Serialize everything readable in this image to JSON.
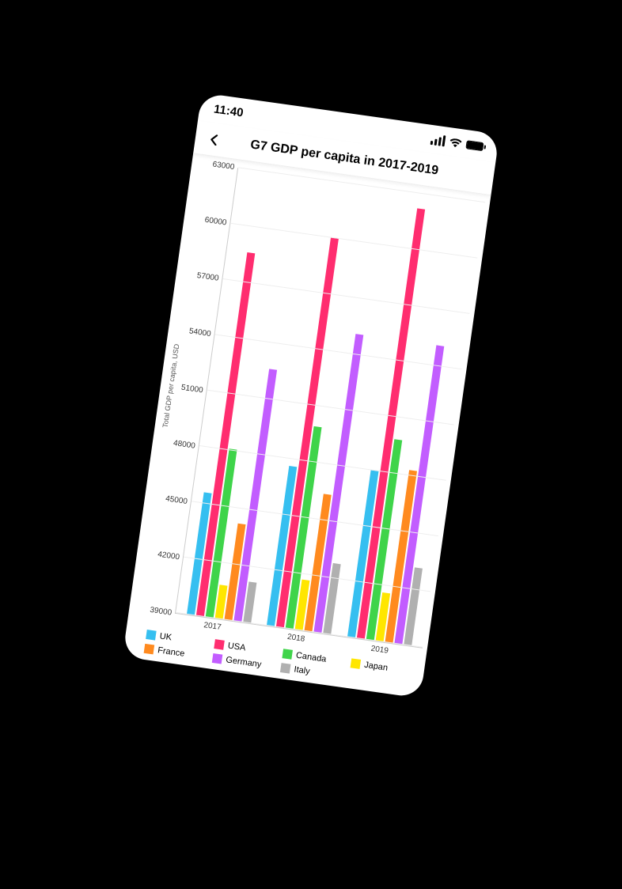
{
  "statusbar": {
    "time": "11:40"
  },
  "header": {
    "title": "G7 GDP per capita in 2017-2019"
  },
  "chart_data": {
    "type": "bar",
    "title": "G7 GDP per capita in 2017-2019",
    "xlabel": "",
    "ylabel": "Total GDP per capita, USD",
    "ylim": [
      39000,
      63000
    ],
    "yticks": [
      39000,
      42000,
      45000,
      48000,
      51000,
      54000,
      57000,
      60000,
      63000
    ],
    "categories": [
      "2017",
      "2018",
      "2019"
    ],
    "series": [
      {
        "name": "UK",
        "color": "#36bff0",
        "values": [
          45600,
          47600,
          48000
        ]
      },
      {
        "name": "USA",
        "color": "#ff2d6f",
        "values": [
          58600,
          60000,
          62200
        ]
      },
      {
        "name": "Canada",
        "color": "#3fd44a",
        "values": [
          48100,
          49900,
          49800
        ]
      },
      {
        "name": "Japan",
        "color": "#ffe600",
        "values": [
          40800,
          41700,
          41600
        ]
      },
      {
        "name": "France",
        "color": "#ff8a1f",
        "values": [
          44200,
          46400,
          48300
        ]
      },
      {
        "name": "Germany",
        "color": "#c25dff",
        "values": [
          52600,
          55100,
          55100
        ]
      },
      {
        "name": "Italy",
        "color": "#b0b0b0",
        "values": [
          41200,
          42800,
          43200
        ]
      }
    ]
  }
}
